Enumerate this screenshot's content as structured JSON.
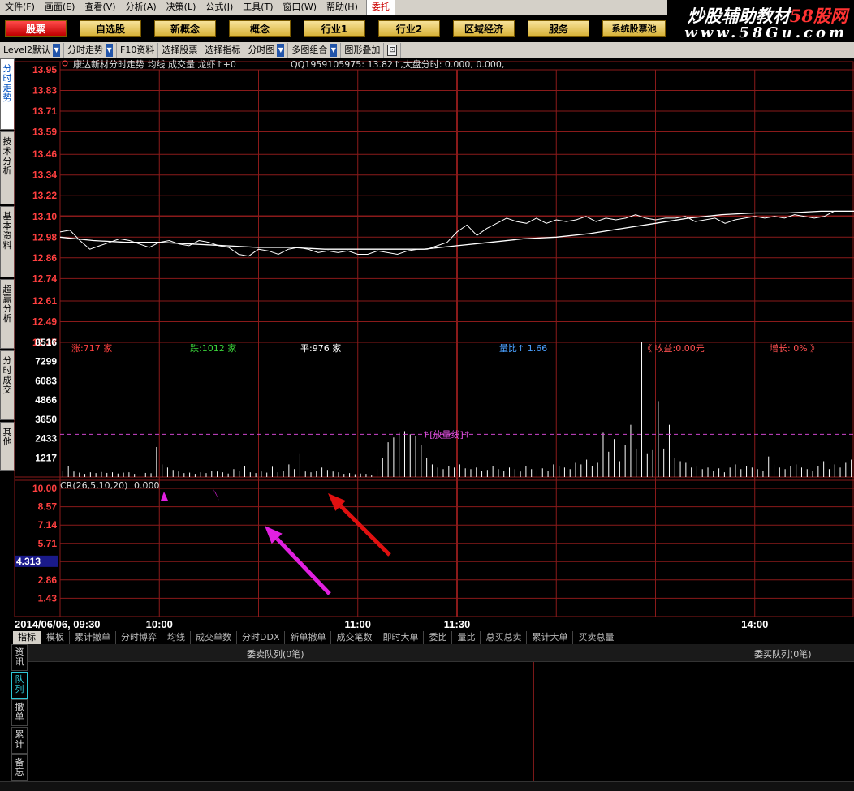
{
  "menu": [
    "文件(F)",
    "画面(E)",
    "查看(V)",
    "分析(A)",
    "决策(L)",
    "公式(J)",
    "工具(T)",
    "窗口(W)",
    "帮助(H)",
    "委托"
  ],
  "watermark": {
    "title_a": "炒股辅助教材",
    "title_b": "58股网",
    "url": "www.58Gu.com"
  },
  "func_buttons": [
    "股票",
    "自选股",
    "新概念",
    "概念",
    "行业1",
    "行业2",
    "区域经济",
    "服务",
    "系统股票池"
  ],
  "toolbar": {
    "items": [
      "Level2默认",
      "分时走势",
      "F10资料",
      "选择股票",
      "选择指标",
      "分时图",
      "多图组合",
      "图形叠加"
    ]
  },
  "left_tabs": [
    "分时走势",
    "技术分析",
    "基本资料",
    "超赢分析",
    "分时成交",
    "其他"
  ],
  "chart_data": [
    {
      "type": "line",
      "header": "康达新材分时走势 均线 成交量 龙虾↑+0",
      "info": "QQ1959105975: 13.82↑,大盘分时: 0.000, 0.000,",
      "y_ticks": [
        "13.95",
        "13.83",
        "13.71",
        "13.59",
        "13.46",
        "13.34",
        "13.22",
        "13.10",
        "12.98",
        "12.86",
        "12.74",
        "12.61",
        "12.49",
        "12.37"
      ],
      "ylim": [
        12.37,
        13.95
      ],
      "prev_close": 13.1,
      "xlim": [
        0,
        240
      ],
      "series": [
        {
          "values": [
            [
              0,
              13.01
            ],
            [
              3,
              13.02
            ],
            [
              6,
              12.96
            ],
            [
              9,
              12.91
            ],
            [
              12,
              12.93
            ],
            [
              15,
              12.95
            ],
            [
              18,
              12.97
            ],
            [
              21,
              12.96
            ],
            [
              24,
              12.94
            ],
            [
              27,
              12.92
            ],
            [
              30,
              12.95
            ],
            [
              33,
              12.96
            ],
            [
              36,
              12.94
            ],
            [
              39,
              12.93
            ],
            [
              42,
              12.96
            ],
            [
              45,
              12.95
            ],
            [
              48,
              12.93
            ],
            [
              51,
              12.92
            ],
            [
              54,
              12.88
            ],
            [
              57,
              12.87
            ],
            [
              60,
              12.91
            ],
            [
              63,
              12.9
            ],
            [
              66,
              12.88
            ],
            [
              69,
              12.91
            ],
            [
              72,
              12.92
            ],
            [
              75,
              12.91
            ],
            [
              78,
              12.89
            ],
            [
              81,
              12.9
            ],
            [
              84,
              12.89
            ],
            [
              87,
              12.9
            ],
            [
              90,
              12.88
            ],
            [
              93,
              12.88
            ],
            [
              96,
              12.9
            ],
            [
              99,
              12.89
            ],
            [
              102,
              12.88
            ],
            [
              105,
              12.9
            ],
            [
              108,
              12.91
            ],
            [
              111,
              12.91
            ],
            [
              114,
              12.93
            ],
            [
              117,
              12.95
            ],
            [
              120,
              13.01
            ],
            [
              123,
              13.05
            ],
            [
              126,
              12.99
            ],
            [
              129,
              13.03
            ],
            [
              132,
              13.06
            ],
            [
              135,
              13.09
            ],
            [
              138,
              13.07
            ],
            [
              141,
              13.06
            ],
            [
              144,
              13.09
            ],
            [
              147,
              13.06
            ],
            [
              150,
              13.08
            ],
            [
              153,
              13.07
            ],
            [
              156,
              13.08
            ],
            [
              159,
              13.1
            ],
            [
              162,
              13.07
            ],
            [
              165,
              13.09
            ],
            [
              168,
              13.08
            ],
            [
              171,
              13.09
            ],
            [
              174,
              13.11
            ],
            [
              177,
              13.09
            ],
            [
              180,
              13.08
            ],
            [
              183,
              13.09
            ],
            [
              186,
              13.09
            ],
            [
              189,
              13.1
            ],
            [
              192,
              13.07
            ],
            [
              195,
              13.08
            ],
            [
              198,
              13.09
            ],
            [
              201,
              13.06
            ],
            [
              204,
              13.08
            ],
            [
              207,
              13.09
            ],
            [
              210,
              13.1
            ],
            [
              213,
              13.09
            ],
            [
              216,
              13.1
            ],
            [
              219,
              13.09
            ],
            [
              222,
              13.11
            ],
            [
              225,
              13.1
            ],
            [
              228,
              13.09
            ],
            [
              231,
              13.1
            ],
            [
              234,
              13.13
            ],
            [
              240,
              13.13
            ]
          ]
        },
        {
          "values": [
            [
              0,
              12.98
            ],
            [
              10,
              12.96
            ],
            [
              20,
              12.95
            ],
            [
              30,
              12.95
            ],
            [
              40,
              12.94
            ],
            [
              50,
              12.93
            ],
            [
              60,
              12.92
            ],
            [
              70,
              12.92
            ],
            [
              80,
              12.91
            ],
            [
              90,
              12.91
            ],
            [
              100,
              12.91
            ],
            [
              110,
              12.91
            ],
            [
              115,
              12.92
            ],
            [
              120,
              12.93
            ],
            [
              130,
              12.95
            ],
            [
              140,
              12.97
            ],
            [
              150,
              12.98
            ],
            [
              160,
              13.0
            ],
            [
              170,
              13.03
            ],
            [
              180,
              13.06
            ],
            [
              190,
              13.09
            ],
            [
              200,
              13.11
            ],
            [
              210,
              13.12
            ],
            [
              220,
              13.12
            ],
            [
              230,
              13.13
            ],
            [
              240,
              13.13
            ]
          ]
        }
      ]
    },
    {
      "type": "bar",
      "y_ticks": [
        "8516",
        "7299",
        "6083",
        "4866",
        "3650",
        "2433",
        "1217"
      ],
      "ylim": [
        0,
        8516
      ],
      "up_label": "涨:717 家",
      "down_label": "跌:1012 家",
      "flat_label": "平:976 家",
      "volume_ratio": "量比↑ 1.66",
      "profit": "《 收益:0.00元",
      "growth": "增长: 0% 》",
      "volume_line_label": "↑[放量线]↑",
      "volume_line_value": 2700,
      "values": [
        400,
        700,
        350,
        280,
        200,
        300,
        250,
        320,
        260,
        300,
        220,
        280,
        300,
        200,
        180,
        260,
        240,
        1900,
        800,
        600,
        450,
        350,
        250,
        280,
        200,
        300,
        250,
        400,
        350,
        300,
        220,
        500,
        400,
        700,
        300,
        250,
        350,
        280,
        650,
        300,
        400,
        800,
        500,
        1500,
        350,
        300,
        400,
        600,
        450,
        350,
        300,
        200,
        250,
        180,
        220,
        200,
        150,
        500,
        1200,
        2200,
        2500,
        2800,
        2900,
        2700,
        2600,
        2000,
        1200,
        800,
        600,
        500,
        700,
        600,
        800,
        550,
        500,
        600,
        400,
        450,
        700,
        500,
        400,
        600,
        500,
        350,
        700,
        500,
        450,
        550,
        400,
        800,
        700,
        600,
        500,
        900,
        800,
        1100,
        700,
        900,
        2800,
        1600,
        2400,
        1000,
        2000,
        3300,
        1800,
        8516,
        1500,
        1700,
        4800,
        1800,
        3300,
        1200,
        1000,
        900,
        600,
        700,
        500,
        600,
        400,
        550,
        300,
        600,
        800,
        500,
        700,
        600,
        500,
        400,
        1300,
        800,
        600,
        500,
        700,
        800,
        600,
        500,
        400,
        700,
        1000,
        500,
        800,
        600,
        900,
        1100
      ]
    },
    {
      "type": "line",
      "label": "CR(26,5,10,20)",
      "value_label": "0.000",
      "y_ticks": [
        "10.00",
        "8.57",
        "7.14",
        "5.71",
        "4.29",
        "2.86",
        "1.43"
      ],
      "ylim": [
        0,
        10
      ],
      "cursor_value": "4.313",
      "x_ticks": [
        {
          "t": 30,
          "label": "10:00"
        },
        {
          "t": 90,
          "label": "11:00"
        },
        {
          "t": 120,
          "label": "11:30"
        },
        {
          "t": 210,
          "label": "14:00"
        }
      ],
      "date_label": "2014/06/06, 09:30"
    }
  ],
  "indicator_tabs": [
    "指标",
    "模板",
    "累计撤单",
    "分时博弈",
    "均线",
    "成交单数",
    "分时DDX",
    "新单撤单",
    "成交笔数",
    "即时大单",
    "委比",
    "量比",
    "总买总卖",
    "累计大单",
    "买卖总量"
  ],
  "queue": {
    "sell_title": "委卖队列(0笔)",
    "buy_title": "委买队列(0笔)",
    "tabs": [
      "资讯",
      "队列",
      "撤单",
      "累计",
      "备忘"
    ]
  },
  "colors": {
    "grid": "#8a1a1a",
    "price_axis": "#ff4040",
    "bar": "#ffffff",
    "avg_line": "#ffffff",
    "arrow_magenta": "#e020e0",
    "arrow_red": "#e01010"
  }
}
